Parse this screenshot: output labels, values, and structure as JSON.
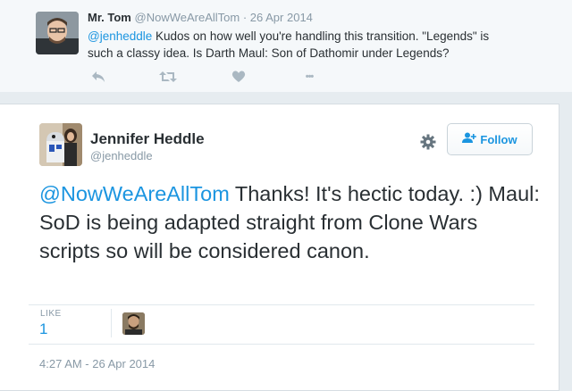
{
  "reply_tweet": {
    "author_name": "Mr. Tom",
    "author_handle": "@NowWeAreAllTom",
    "separator": " · ",
    "date": "26 Apr 2014",
    "mention": "@jenheddle",
    "text": " Kudos on how well you're handling this transition. \"Legends\" is such a classy idea. Is Darth Maul: Son of Dathomir under Legends?",
    "more_label": "•••"
  },
  "main_tweet": {
    "author_name": "Jennifer Heddle",
    "author_handle": "@jenheddle",
    "follow_label": "Follow",
    "mention": "@NowWeAreAllTom",
    "text": " Thanks! It's hectic today. :) Maul: SoD is being adapted straight from Clone Wars scripts so will be considered canon.",
    "like_label": "LIKE",
    "like_count": "1",
    "timestamp": "4:27 AM - 26 Apr 2014"
  },
  "icons": {
    "reply": "reply-icon",
    "retweet": "retweet-icon",
    "like": "heart-icon",
    "more": "more-icon",
    "settings": "gear-icon",
    "follow": "add-person-icon"
  },
  "colors": {
    "accent": "#1b95e0",
    "muted": "#8899a6",
    "text": "#292f33",
    "icon_gray": "#aab8c2"
  }
}
